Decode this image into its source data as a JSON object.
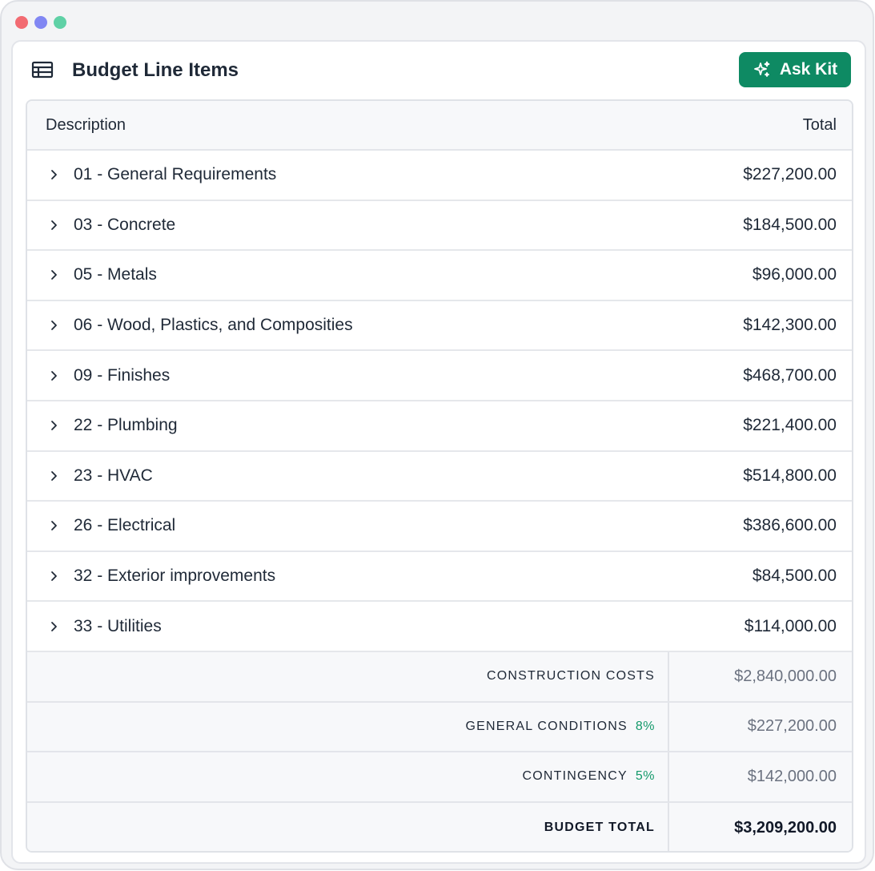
{
  "header": {
    "title": "Budget Line Items",
    "ask_button_label": "Ask Kit",
    "table_icon": "table-icon",
    "sparkle_icon": "sparkles-icon"
  },
  "colors": {
    "accent": "#0e8a63",
    "percent_text": "#149a6b"
  },
  "table": {
    "columns": [
      "Description",
      "Total"
    ],
    "rows": [
      {
        "description": "01 - General Requirements",
        "total": "$227,200.00"
      },
      {
        "description": "03 - Concrete",
        "total": "$184,500.00"
      },
      {
        "description": "05 - Metals",
        "total": "$96,000.00"
      },
      {
        "description": "06 - Wood, Plastics, and Composities",
        "total": "$142,300.00"
      },
      {
        "description": "09 - Finishes",
        "total": "$468,700.00"
      },
      {
        "description": "22 - Plumbing",
        "total": "$221,400.00"
      },
      {
        "description": "23 - HVAC",
        "total": "$514,800.00"
      },
      {
        "description": "26 - Electrical",
        "total": "$386,600.00"
      },
      {
        "description": "32 - Exterior improvements",
        "total": "$84,500.00"
      },
      {
        "description": "33 - Utilities",
        "total": "$114,000.00"
      }
    ],
    "summary": [
      {
        "label": "CONSTRUCTION COSTS",
        "percent": "",
        "value": "$2,840,000.00"
      },
      {
        "label": "GENERAL CONDITIONS",
        "percent": "8%",
        "value": "$227,200.00"
      },
      {
        "label": "CONTINGENCY",
        "percent": "5%",
        "value": "$142,000.00"
      },
      {
        "label": "BUDGET TOTAL",
        "percent": "",
        "value": "$3,209,200.00"
      }
    ]
  }
}
